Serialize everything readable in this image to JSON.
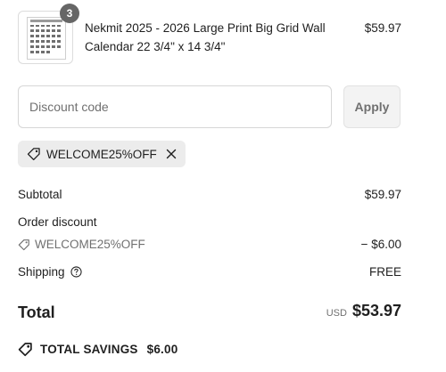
{
  "product": {
    "quantity": "3",
    "name": "Nekmit 2025 - 2026 Large Print Big Grid Wall Calendar 22 3/4\" x 14 3/4\"",
    "price": "$59.97"
  },
  "discount": {
    "placeholder": "Discount code",
    "value": "",
    "apply_label": "Apply",
    "applied_code": "WELCOME25%OFF"
  },
  "summary": {
    "subtotal_label": "Subtotal",
    "subtotal_value": "$59.97",
    "order_discount_label": "Order discount",
    "discount_code": "WELCOME25%OFF",
    "discount_value": "− $6.00",
    "shipping_label": "Shipping",
    "shipping_value": "FREE"
  },
  "total": {
    "label": "Total",
    "currency": "USD",
    "amount": "$53.97"
  },
  "savings": {
    "label": "TOTAL SAVINGS",
    "amount": "$6.00"
  },
  "colors": {
    "text": "#1f1f1f",
    "muted": "#707070",
    "badge": "#666666",
    "tag_background": "#ececec",
    "border": "#d6d6d6"
  },
  "icons": [
    "calendar-thumbnail",
    "tag-icon",
    "close-icon",
    "help-circle-icon",
    "savings-tag-icon"
  ]
}
